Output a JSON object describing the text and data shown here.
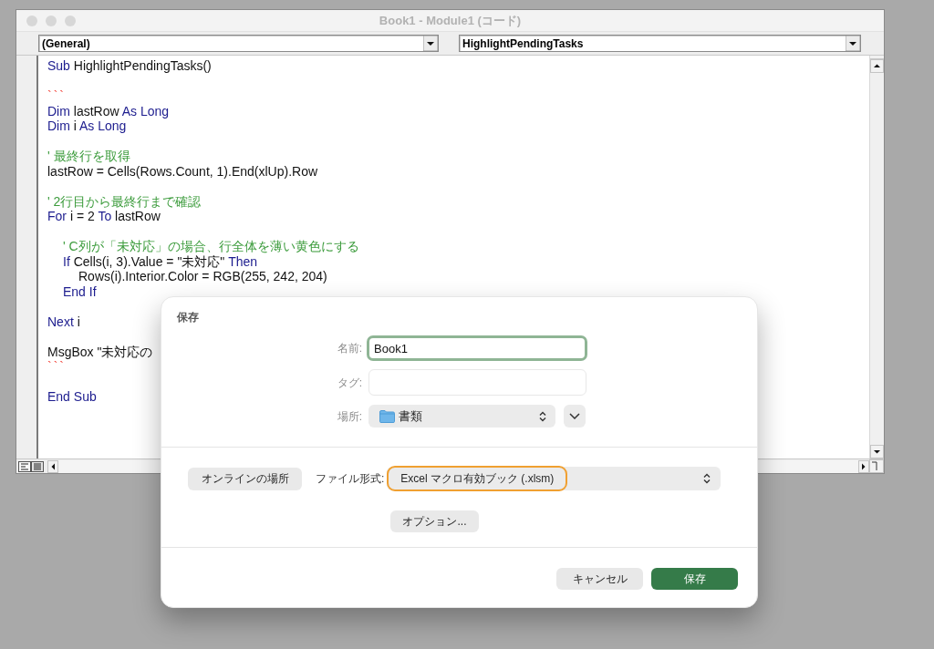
{
  "window": {
    "title": "Book1 - Module1 (コード)"
  },
  "toolbar": {
    "object_dropdown": {
      "value": "(General)"
    },
    "procedure_dropdown": {
      "value": "HighlightPendingTasks"
    }
  },
  "code": {
    "lines": [
      {
        "kind": "code",
        "tokens": [
          {
            "kind": "keyword",
            "text": "Sub"
          },
          {
            "kind": "plain",
            "text": " HighlightPendingTasks()"
          }
        ]
      },
      {
        "kind": "blank"
      },
      {
        "kind": "code",
        "tokens": [
          {
            "kind": "error",
            "text": "```"
          }
        ]
      },
      {
        "kind": "code",
        "tokens": [
          {
            "kind": "keyword",
            "text": "Dim"
          },
          {
            "kind": "plain",
            "text": " lastRow "
          },
          {
            "kind": "keyword",
            "text": "As Long"
          }
        ]
      },
      {
        "kind": "code",
        "tokens": [
          {
            "kind": "keyword",
            "text": "Dim"
          },
          {
            "kind": "plain",
            "text": " i "
          },
          {
            "kind": "keyword",
            "text": "As Long"
          }
        ]
      },
      {
        "kind": "blank"
      },
      {
        "kind": "code",
        "tokens": [
          {
            "kind": "comment",
            "text": "' 最終行を取得"
          }
        ]
      },
      {
        "kind": "code",
        "tokens": [
          {
            "kind": "plain",
            "text": "lastRow = Cells(Rows.Count, 1).End(xlUp).Row"
          }
        ]
      },
      {
        "kind": "blank"
      },
      {
        "kind": "code",
        "tokens": [
          {
            "kind": "comment",
            "text": "' 2行目から最終行まで確認"
          }
        ]
      },
      {
        "kind": "code",
        "tokens": [
          {
            "kind": "keyword",
            "text": "For"
          },
          {
            "kind": "plain",
            "text": " i = 2 "
          },
          {
            "kind": "keyword",
            "text": "To"
          },
          {
            "kind": "plain",
            "text": " lastRow"
          }
        ],
        "children": [
          {
            "kind": "blank"
          },
          {
            "kind": "code",
            "tokens": [
              {
                "kind": "comment",
                "text": "' C列が「未対応」の場合、行全体を薄い黄色にする"
              }
            ]
          },
          {
            "kind": "code",
            "tokens": [
              {
                "kind": "keyword",
                "text": "If"
              },
              {
                "kind": "plain",
                "text": " Cells(i, 3).Value = \"未対応\" "
              },
              {
                "kind": "keyword",
                "text": "Then"
              }
            ],
            "children": [
              {
                "kind": "code",
                "tokens": [
                  {
                    "kind": "plain",
                    "text": "Rows(i).Interior.Color = RGB(255, 242, 204)"
                  }
                ]
              }
            ]
          },
          {
            "kind": "code",
            "tokens": [
              {
                "kind": "keyword",
                "text": "End If"
              }
            ]
          }
        ]
      },
      {
        "kind": "blank"
      },
      {
        "kind": "code",
        "tokens": [
          {
            "kind": "keyword",
            "text": "Next"
          },
          {
            "kind": "plain",
            "text": " i"
          }
        ]
      },
      {
        "kind": "blank"
      },
      {
        "kind": "code",
        "tokens": [
          {
            "kind": "plain",
            "text": "MsgBox \"未対応の"
          }
        ]
      },
      {
        "kind": "code",
        "tokens": [
          {
            "kind": "error",
            "text": "```"
          }
        ]
      },
      {
        "kind": "blank"
      },
      {
        "kind": "code",
        "tokens": [
          {
            "kind": "keyword",
            "text": "End Sub"
          }
        ]
      }
    ]
  },
  "save_dialog": {
    "title": "保存",
    "name_field": {
      "label": "名前:",
      "value": "Book1",
      "focused": true
    },
    "tags_field": {
      "label": "タグ:",
      "focused": false
    },
    "location": {
      "label": "場所:",
      "value": "書類"
    },
    "online_locations_button": {
      "label": "オンラインの場所"
    },
    "file_format": {
      "label": "ファイル形式:",
      "value": "Excel マクロ有効ブック (.xlsm)",
      "highlighted": true
    },
    "options_button": {
      "label": "オプション..."
    },
    "buttons": [
      {
        "label": "キャンセル",
        "kind": "secondary"
      },
      {
        "label": "保存",
        "kind": "primary"
      }
    ]
  }
}
